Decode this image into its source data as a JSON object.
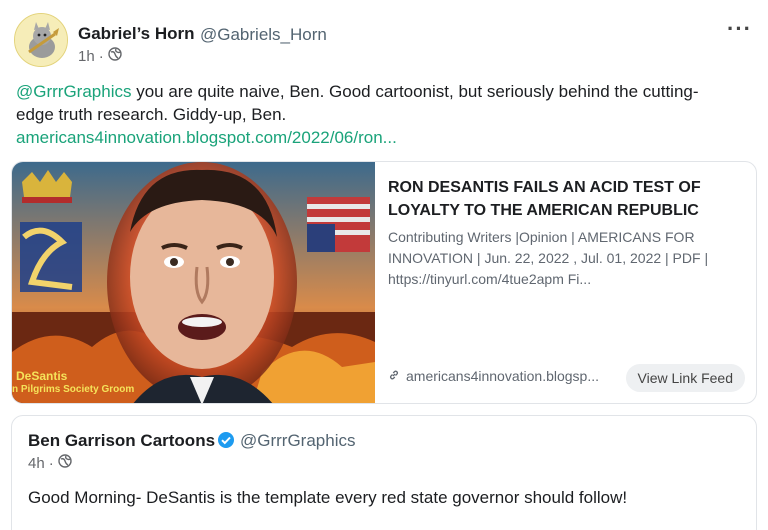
{
  "post": {
    "display_name": "Gabriel’s Horn",
    "handle": "@Gabriels_Horn",
    "time": "1h",
    "text_mention": "@GrrrGraphics",
    "text_body": " you are quite naive, Ben. Good cartoonist, but seriously behind the cutting-edge truth research. Giddy-up, Ben.",
    "link_text": "americans4innovation.blogspot.com/2022/06/ron..."
  },
  "preview": {
    "title": "RON DESANTIS FAILS AN ACID TEST OF LOYALTY TO THE AMERICAN REPUBLIC",
    "description": "    Contributing Writers |Opinion | AMERICANS FOR INNOVATION    | Jun. 22, 2022   , Jul. 01, 2022   | PDF   | https://tinyurl.com/4tue2apm     Fi...",
    "domain": "americans4innovation.blogsp...",
    "view_feed_label": "View Link Feed",
    "image_caption_1": "DeSantis",
    "image_caption_2": "n Pilgrims Society Groom"
  },
  "quoted": {
    "display_name": "Ben Garrison Cartoons",
    "handle": "@GrrrGraphics",
    "time": "4h",
    "text": "Good Morning- DeSantis is the template every red state governor should follow!"
  },
  "icons": {
    "more": "more-options-icon",
    "globe": "public-globe-icon",
    "link": "link-icon",
    "verified": "verified-badge-icon"
  },
  "colors": {
    "link": "#1aa37a",
    "verified": "#1d9bf0"
  }
}
